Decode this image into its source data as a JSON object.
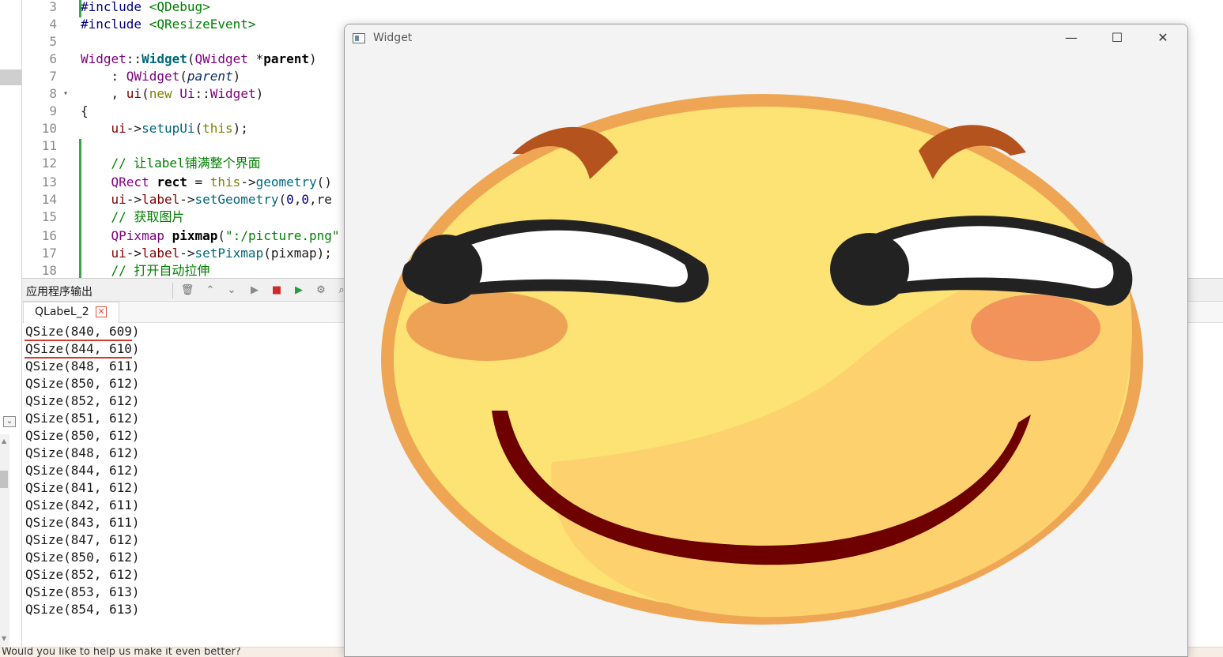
{
  "editor": {
    "lines": [
      {
        "num": "3",
        "tokens": [
          {
            "c": "t-pp",
            "t": "#include "
          },
          {
            "c": "t-inc",
            "t": "<QDebug>"
          }
        ]
      },
      {
        "num": "4",
        "tokens": [
          {
            "c": "t-pp",
            "t": "#include "
          },
          {
            "c": "t-inc",
            "t": "<QResizeEvent>"
          }
        ]
      },
      {
        "num": "5",
        "tokens": []
      },
      {
        "num": "6",
        "tokens": [
          {
            "c": "t-cls",
            "t": "Widget"
          },
          {
            "c": "",
            "t": "::"
          },
          {
            "c": "t-fn",
            "t": "Widget"
          },
          {
            "c": "",
            "t": "("
          },
          {
            "c": "t-cls",
            "t": "QWidget"
          },
          {
            "c": "",
            "t": " *"
          },
          {
            "c": "t-bold",
            "t": "parent"
          },
          {
            "c": "",
            "t": ")"
          }
        ]
      },
      {
        "num": "7",
        "tokens": [
          {
            "c": "",
            "t": "    : "
          },
          {
            "c": "t-cls",
            "t": "QWidget"
          },
          {
            "c": "",
            "t": "("
          },
          {
            "c": "t-par",
            "t": "parent"
          },
          {
            "c": "",
            "t": ")"
          }
        ]
      },
      {
        "num": "8",
        "fold": "▾",
        "tokens": [
          {
            "c": "",
            "t": "    , "
          },
          {
            "c": "t-mem",
            "t": "ui"
          },
          {
            "c": "",
            "t": "("
          },
          {
            "c": "t-kw",
            "t": "new"
          },
          {
            "c": "",
            "t": " "
          },
          {
            "c": "t-cls",
            "t": "Ui"
          },
          {
            "c": "",
            "t": "::"
          },
          {
            "c": "t-cls",
            "t": "Widget"
          },
          {
            "c": "",
            "t": ")"
          }
        ]
      },
      {
        "num": "9",
        "tokens": [
          {
            "c": "",
            "t": "{"
          }
        ]
      },
      {
        "num": "10",
        "tokens": [
          {
            "c": "",
            "t": "    "
          },
          {
            "c": "t-mem",
            "t": "ui"
          },
          {
            "c": "",
            "t": "->"
          },
          {
            "c": "t-call",
            "t": "setupUi"
          },
          {
            "c": "",
            "t": "("
          },
          {
            "c": "t-kw",
            "t": "this"
          },
          {
            "c": "",
            "t": ");"
          }
        ]
      },
      {
        "num": "11",
        "tokens": []
      },
      {
        "num": "12",
        "tokens": [
          {
            "c": "t-cmt",
            "t": "    // 让label铺满整个界面"
          }
        ]
      },
      {
        "num": "13",
        "tokens": [
          {
            "c": "",
            "t": "    "
          },
          {
            "c": "t-cls",
            "t": "QRect"
          },
          {
            "c": "",
            "t": " "
          },
          {
            "c": "t-bold",
            "t": "rect"
          },
          {
            "c": "",
            "t": " = "
          },
          {
            "c": "t-kw",
            "t": "this"
          },
          {
            "c": "",
            "t": "->"
          },
          {
            "c": "t-call",
            "t": "geometry"
          },
          {
            "c": "",
            "t": "()"
          }
        ]
      },
      {
        "num": "14",
        "tokens": [
          {
            "c": "",
            "t": "    "
          },
          {
            "c": "t-mem",
            "t": "ui"
          },
          {
            "c": "",
            "t": "->"
          },
          {
            "c": "t-mem",
            "t": "label"
          },
          {
            "c": "",
            "t": "->"
          },
          {
            "c": "t-call",
            "t": "setGeometry"
          },
          {
            "c": "",
            "t": "("
          },
          {
            "c": "t-num",
            "t": "0"
          },
          {
            "c": "",
            "t": ","
          },
          {
            "c": "t-num",
            "t": "0"
          },
          {
            "c": "",
            "t": ",re"
          }
        ]
      },
      {
        "num": "15",
        "tokens": [
          {
            "c": "t-cmt",
            "t": "    // 获取图片"
          }
        ]
      },
      {
        "num": "16",
        "tokens": [
          {
            "c": "",
            "t": "    "
          },
          {
            "c": "t-cls",
            "t": "QPixmap"
          },
          {
            "c": "",
            "t": " "
          },
          {
            "c": "t-bold",
            "t": "pixmap"
          },
          {
            "c": "",
            "t": "("
          },
          {
            "c": "t-str",
            "t": "\":/picture.png\""
          }
        ]
      },
      {
        "num": "17",
        "tokens": [
          {
            "c": "",
            "t": "    "
          },
          {
            "c": "t-mem",
            "t": "ui"
          },
          {
            "c": "",
            "t": "->"
          },
          {
            "c": "t-mem",
            "t": "label"
          },
          {
            "c": "",
            "t": "->"
          },
          {
            "c": "t-call",
            "t": "setPixmap"
          },
          {
            "c": "",
            "t": "(pixmap);"
          }
        ]
      },
      {
        "num": "18",
        "tokens": [
          {
            "c": "t-cmt",
            "t": "    // 打开自动拉伸"
          }
        ]
      }
    ]
  },
  "output_pane": {
    "title": "应用程序输出",
    "tab_label": "QLabeL_2",
    "tab_close": "✕",
    "toolbar_icons": [
      "trash-icon",
      "arrow-up-icon",
      "arrow-down-icon",
      "run-icon",
      "stop-icon",
      "run-debug-icon",
      "settings-icon",
      "search-icon"
    ],
    "lines": [
      "QSize(840, 609)",
      "QSize(844, 610)",
      "QSize(848, 611)",
      "QSize(850, 612)",
      "QSize(852, 612)",
      "QSize(851, 612)",
      "QSize(850, 612)",
      "QSize(848, 612)",
      "QSize(844, 612)",
      "QSize(841, 612)",
      "QSize(842, 611)",
      "QSize(843, 611)",
      "QSize(847, 612)",
      "QSize(850, 612)",
      "QSize(852, 612)",
      "QSize(853, 613)",
      "QSize(854, 613)"
    ],
    "underlined_rows": [
      0,
      1
    ]
  },
  "status_bar": {
    "text": "Would you like to help us make it even better?"
  },
  "widget_window": {
    "title": "Widget",
    "minimize": "—",
    "maximize": "☐",
    "close": "✕"
  },
  "colors": {
    "accent_underline": "#d43a2a",
    "face_fill": "#fde274",
    "face_outline": "#eea655",
    "eyebrow": "#b4531e",
    "mouth": "#6e0000",
    "blush_left": "#eea255",
    "blush_right": "#f1935a"
  }
}
